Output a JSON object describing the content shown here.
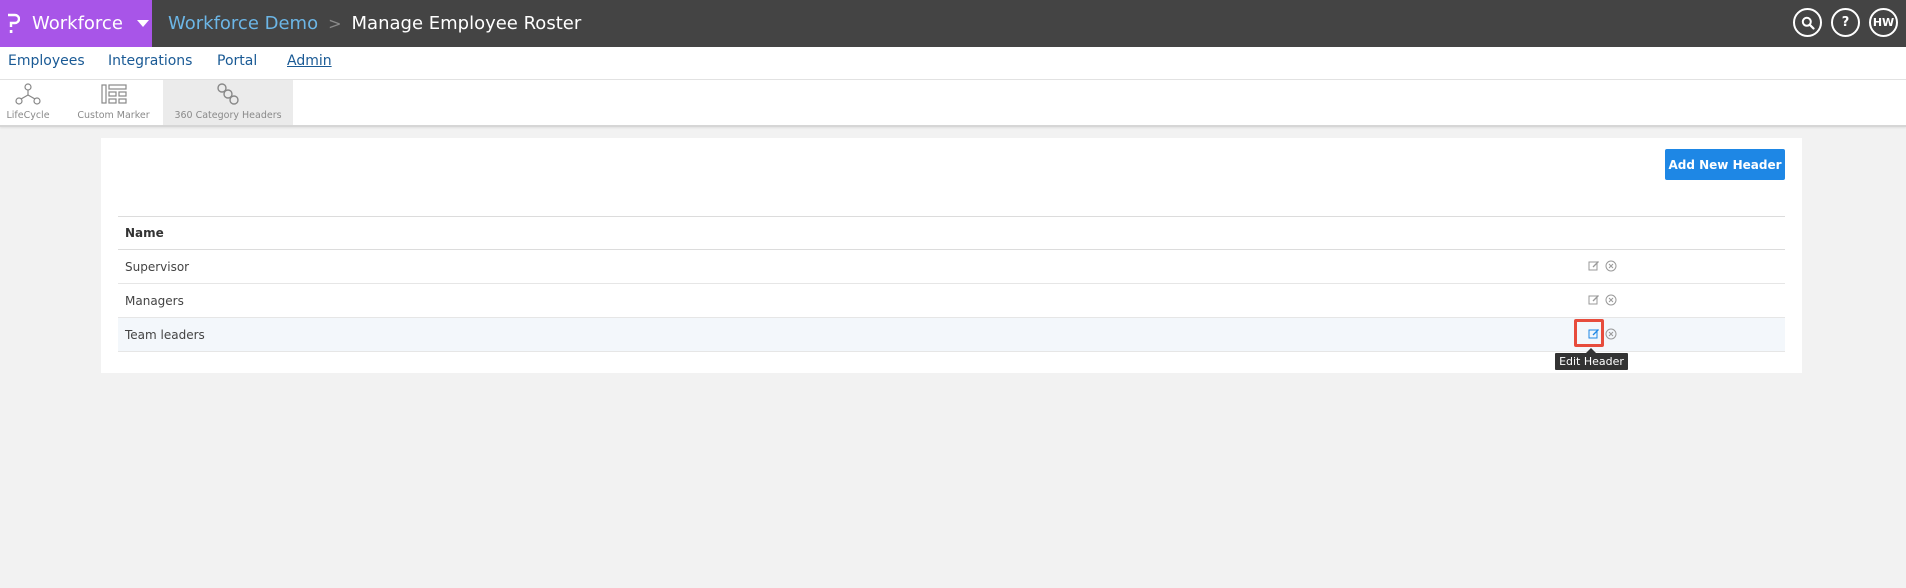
{
  "header": {
    "app_name": "Workforce",
    "breadcrumb_parent": "Workforce Demo",
    "breadcrumb_separator": ">",
    "page_title": "Manage Employee Roster",
    "help_label": "?",
    "user_initials": "HW",
    "brand_color": "#a855e8",
    "bar_color": "#444444"
  },
  "nav": {
    "items": [
      {
        "label": "Employees",
        "active": false
      },
      {
        "label": "Integrations",
        "active": false
      },
      {
        "label": "Portal",
        "active": false
      },
      {
        "label": "Admin",
        "active": true
      }
    ]
  },
  "subnav": {
    "items": [
      {
        "label": "LifeCycle",
        "icon": "lifecycle-icon"
      },
      {
        "label": "Custom Marker",
        "icon": "custom-marker-icon"
      },
      {
        "label": "360 Category Headers",
        "icon": "link-chain-icon",
        "active": true
      }
    ]
  },
  "main": {
    "add_button_label": "Add New Header",
    "add_button_color": "#1e87e5",
    "table": {
      "column_header": "Name",
      "rows": [
        {
          "name": "Supervisor"
        },
        {
          "name": "Managers"
        },
        {
          "name": "Team leaders"
        }
      ]
    },
    "tooltip": "Edit Header",
    "highlight_color": "#e74c3c"
  }
}
